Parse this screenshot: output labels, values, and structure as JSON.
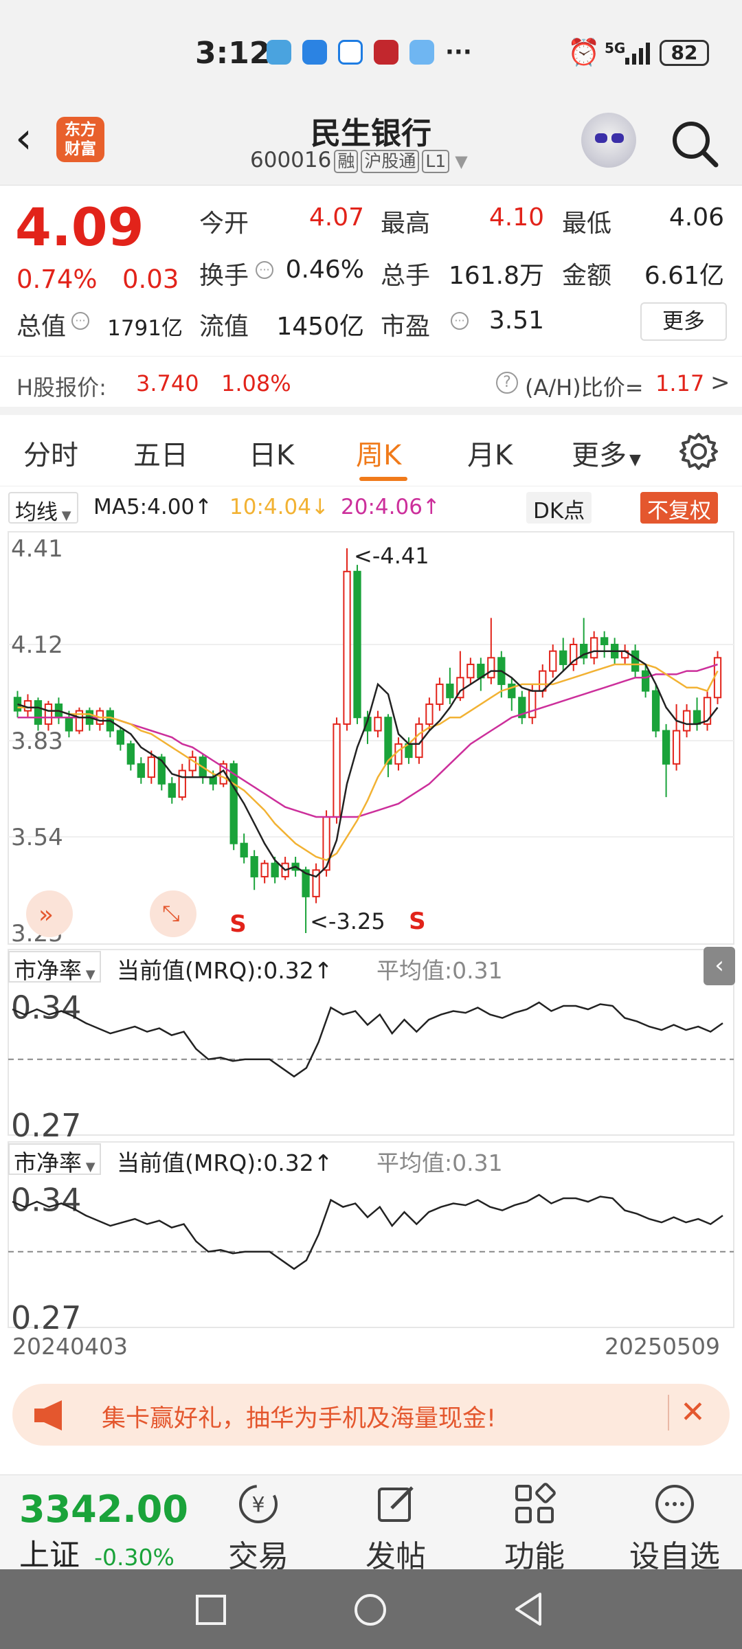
{
  "status": {
    "time": "3:12",
    "battery": "82",
    "network": "5G"
  },
  "header": {
    "title": "民生银行",
    "code": "600016",
    "tags": [
      "融",
      "沪股通",
      "L1"
    ],
    "logo_text": [
      "东方",
      "财富"
    ]
  },
  "quote": {
    "price": "4.09",
    "change_pct": "0.74%",
    "change": "0.03",
    "fields": [
      {
        "label": "今开",
        "value": "4.07",
        "color": "red"
      },
      {
        "label": "最高",
        "value": "4.10",
        "color": "red"
      },
      {
        "label": "最低",
        "value": "4.06",
        "color": "black"
      },
      {
        "label": "换手",
        "value": "0.46%",
        "color": "black"
      },
      {
        "label": "总手",
        "value": "161.8万",
        "color": "black"
      },
      {
        "label": "金额",
        "value": "6.61亿",
        "color": "black"
      },
      {
        "label": "总值",
        "value": "1791亿",
        "color": "black"
      },
      {
        "label": "流值",
        "value": "1450亿",
        "color": "black"
      },
      {
        "label": "市盈",
        "value": "3.51",
        "color": "black"
      }
    ],
    "more_label": "更多",
    "h_label": "H股报价:",
    "h_price": "3.740",
    "h_pct": "1.08%",
    "ah_label": "(A/H)比价=",
    "ah_value": "1.17",
    "ah_arrow": ">"
  },
  "tabs": [
    "分时",
    "五日",
    "日K",
    "周K",
    "月K",
    "更多"
  ],
  "active_tab": "周K",
  "ma": {
    "selector": "均线",
    "ma5": "MA5:4.00↑",
    "ma10": "10:4.04↓",
    "ma20": "20:4.06↑",
    "dk": "DK点",
    "fq": "不复权"
  },
  "colors": {
    "up": "#e2231a",
    "down": "#1aa33a",
    "ma5": "#222222",
    "ma10": "#f2b233",
    "ma20": "#cc2f9b",
    "accent": "#f07a1a"
  },
  "chart_data": {
    "type": "candlestick",
    "y_ticks": [
      "4.41",
      "4.12",
      "3.83",
      "3.54",
      "3.25"
    ],
    "ylim": [
      3.25,
      4.41
    ],
    "high_label": "<-4.41",
    "low_label": "<-3.25",
    "signal_label": "S",
    "candles": [
      [
        3.96,
        3.92,
        3.98,
        3.9
      ],
      [
        3.92,
        3.95,
        3.97,
        3.9
      ],
      [
        3.95,
        3.88,
        3.96,
        3.86
      ],
      [
        3.88,
        3.94,
        3.95,
        3.86
      ],
      [
        3.94,
        3.9,
        3.96,
        3.88
      ],
      [
        3.9,
        3.86,
        3.92,
        3.84
      ],
      [
        3.86,
        3.92,
        3.93,
        3.85
      ],
      [
        3.92,
        3.88,
        3.93,
        3.86
      ],
      [
        3.88,
        3.92,
        3.93,
        3.86
      ],
      [
        3.92,
        3.86,
        3.93,
        3.84
      ],
      [
        3.86,
        3.82,
        3.87,
        3.8
      ],
      [
        3.82,
        3.76,
        3.83,
        3.74
      ],
      [
        3.76,
        3.72,
        3.78,
        3.7
      ],
      [
        3.72,
        3.78,
        3.8,
        3.7
      ],
      [
        3.78,
        3.7,
        3.79,
        3.68
      ],
      [
        3.7,
        3.66,
        3.72,
        3.64
      ],
      [
        3.66,
        3.74,
        3.76,
        3.65
      ],
      [
        3.74,
        3.78,
        3.8,
        3.72
      ],
      [
        3.78,
        3.72,
        3.79,
        3.7
      ],
      [
        3.72,
        3.7,
        3.74,
        3.68
      ],
      [
        3.7,
        3.76,
        3.77,
        3.69
      ],
      [
        3.76,
        3.52,
        3.77,
        3.5
      ],
      [
        3.52,
        3.48,
        3.55,
        3.46
      ],
      [
        3.48,
        3.42,
        3.5,
        3.38
      ],
      [
        3.42,
        3.46,
        3.47,
        3.4
      ],
      [
        3.46,
        3.42,
        3.48,
        3.4
      ],
      [
        3.42,
        3.46,
        3.48,
        3.41
      ],
      [
        3.46,
        3.44,
        3.48,
        3.42
      ],
      [
        3.44,
        3.36,
        3.45,
        3.25
      ],
      [
        3.36,
        3.44,
        3.46,
        3.34
      ],
      [
        3.44,
        3.6,
        3.62,
        3.42
      ],
      [
        3.6,
        3.88,
        3.9,
        3.58
      ],
      [
        3.88,
        4.34,
        4.41,
        3.86
      ],
      [
        4.34,
        3.9,
        4.36,
        3.88
      ],
      [
        3.9,
        3.86,
        3.92,
        3.82
      ],
      [
        3.86,
        3.9,
        3.92,
        3.84
      ],
      [
        3.9,
        3.76,
        3.91,
        3.72
      ],
      [
        3.76,
        3.82,
        3.84,
        3.74
      ],
      [
        3.82,
        3.78,
        3.84,
        3.76
      ],
      [
        3.78,
        3.88,
        3.9,
        3.76
      ],
      [
        3.88,
        3.94,
        3.96,
        3.86
      ],
      [
        3.94,
        4.0,
        4.02,
        3.92
      ],
      [
        4.0,
        3.96,
        4.05,
        3.94
      ],
      [
        3.96,
        4.02,
        4.1,
        3.95
      ],
      [
        4.02,
        4.06,
        4.08,
        4.0
      ],
      [
        4.06,
        4.02,
        4.08,
        3.98
      ],
      [
        4.02,
        4.08,
        4.2,
        4.0
      ],
      [
        4.08,
        4.0,
        4.1,
        3.96
      ],
      [
        4.0,
        3.96,
        4.02,
        3.92
      ],
      [
        3.96,
        3.9,
        3.98,
        3.88
      ],
      [
        3.9,
        3.98,
        4.0,
        3.88
      ],
      [
        3.98,
        4.04,
        4.06,
        3.96
      ],
      [
        4.04,
        4.1,
        4.12,
        4.02
      ],
      [
        4.1,
        4.06,
        4.14,
        4.04
      ],
      [
        4.06,
        4.12,
        4.14,
        4.04
      ],
      [
        4.12,
        4.08,
        4.2,
        4.06
      ],
      [
        4.08,
        4.14,
        4.16,
        4.06
      ],
      [
        4.14,
        4.12,
        4.16,
        4.08
      ],
      [
        4.12,
        4.08,
        4.14,
        4.06
      ],
      [
        4.08,
        4.1,
        4.12,
        4.06
      ],
      [
        4.1,
        4.04,
        4.12,
        4.02
      ],
      [
        4.04,
        3.98,
        4.06,
        3.96
      ],
      [
        3.98,
        3.86,
        4.0,
        3.84
      ],
      [
        3.86,
        3.76,
        3.88,
        3.66
      ],
      [
        3.76,
        3.86,
        3.94,
        3.74
      ],
      [
        3.86,
        3.92,
        3.94,
        3.84
      ],
      [
        3.92,
        3.88,
        3.96,
        3.86
      ],
      [
        3.88,
        3.96,
        3.98,
        3.86
      ],
      [
        3.96,
        4.08,
        4.1,
        3.94
      ]
    ],
    "ma5": [
      3.94,
      3.93,
      3.93,
      3.92,
      3.92,
      3.91,
      3.9,
      3.9,
      3.89,
      3.89,
      3.87,
      3.85,
      3.81,
      3.79,
      3.77,
      3.73,
      3.72,
      3.72,
      3.72,
      3.72,
      3.74,
      3.69,
      3.64,
      3.58,
      3.52,
      3.47,
      3.44,
      3.45,
      3.43,
      3.42,
      3.45,
      3.53,
      3.7,
      3.81,
      3.89,
      4.0,
      3.97,
      3.85,
      3.82,
      3.82,
      3.86,
      3.89,
      3.93,
      3.98,
      4.0,
      4.02,
      4.04,
      4.04,
      4.02,
      3.99,
      3.98,
      3.98,
      4.01,
      4.04,
      4.07,
      4.09,
      4.1,
      4.1,
      4.1,
      4.1,
      4.08,
      4.06,
      4.0,
      3.93,
      3.89,
      3.88,
      3.88,
      3.89,
      3.93
    ],
    "ma10": [
      3.93,
      3.93,
      3.93,
      3.92,
      3.92,
      3.91,
      3.91,
      3.91,
      3.9,
      3.9,
      3.89,
      3.88,
      3.86,
      3.85,
      3.83,
      3.81,
      3.79,
      3.77,
      3.75,
      3.73,
      3.72,
      3.7,
      3.68,
      3.65,
      3.62,
      3.58,
      3.55,
      3.52,
      3.5,
      3.48,
      3.47,
      3.49,
      3.54,
      3.59,
      3.65,
      3.72,
      3.77,
      3.8,
      3.82,
      3.85,
      3.87,
      3.88,
      3.9,
      3.9,
      3.92,
      3.94,
      3.96,
      3.98,
      3.99,
      4.0,
      4.0,
      4.0,
      4.0,
      4.01,
      4.02,
      4.03,
      4.04,
      4.05,
      4.06,
      4.06,
      4.06,
      4.06,
      4.05,
      4.03,
      4.01,
      3.99,
      3.99,
      3.98,
      4.04
    ],
    "ma20": [
      3.9,
      3.9,
      3.9,
      3.9,
      3.9,
      3.9,
      3.9,
      3.9,
      3.9,
      3.9,
      3.89,
      3.88,
      3.87,
      3.86,
      3.85,
      3.84,
      3.82,
      3.81,
      3.79,
      3.77,
      3.75,
      3.73,
      3.71,
      3.69,
      3.67,
      3.65,
      3.63,
      3.62,
      3.61,
      3.6,
      3.6,
      3.6,
      3.6,
      3.6,
      3.61,
      3.62,
      3.63,
      3.64,
      3.66,
      3.68,
      3.7,
      3.73,
      3.76,
      3.79,
      3.82,
      3.84,
      3.86,
      3.88,
      3.9,
      3.91,
      3.92,
      3.93,
      3.94,
      3.95,
      3.96,
      3.97,
      3.98,
      3.99,
      4.0,
      4.01,
      4.02,
      4.02,
      4.03,
      4.03,
      4.03,
      4.04,
      4.04,
      4.05,
      4.06
    ],
    "indicators": [
      {
        "selector": "市净率",
        "current": "当前值(MRQ):0.32↑",
        "avg": "平均值:0.31",
        "ticks": [
          "0.34",
          "0.27"
        ],
        "ylim": [
          0.27,
          0.345
        ],
        "avg_value": 0.31,
        "values": [
          0.339,
          0.336,
          0.339,
          0.336,
          0.338,
          0.335,
          0.331,
          0.328,
          0.325,
          0.327,
          0.329,
          0.326,
          0.328,
          0.324,
          0.326,
          0.316,
          0.31,
          0.311,
          0.309,
          0.31,
          0.31,
          0.31,
          0.305,
          0.3,
          0.305,
          0.32,
          0.34,
          0.336,
          0.338,
          0.33,
          0.336,
          0.325,
          0.333,
          0.326,
          0.333,
          0.336,
          0.338,
          0.337,
          0.34,
          0.336,
          0.334,
          0.337,
          0.339,
          0.343,
          0.338,
          0.341,
          0.341,
          0.339,
          0.342,
          0.341,
          0.334,
          0.332,
          0.329,
          0.327,
          0.33,
          0.327,
          0.329,
          0.326,
          0.331
        ]
      },
      {
        "selector": "市净率",
        "current": "当前值(MRQ):0.32↑",
        "avg": "平均值:0.31",
        "ticks": [
          "0.34",
          "0.27"
        ],
        "ylim": [
          0.27,
          0.345
        ],
        "avg_value": 0.31,
        "values": [
          0.339,
          0.336,
          0.339,
          0.336,
          0.338,
          0.335,
          0.331,
          0.328,
          0.325,
          0.327,
          0.329,
          0.326,
          0.328,
          0.324,
          0.326,
          0.316,
          0.31,
          0.311,
          0.309,
          0.31,
          0.31,
          0.31,
          0.305,
          0.3,
          0.305,
          0.32,
          0.34,
          0.336,
          0.338,
          0.33,
          0.336,
          0.325,
          0.333,
          0.326,
          0.333,
          0.336,
          0.338,
          0.337,
          0.34,
          0.336,
          0.334,
          0.337,
          0.339,
          0.343,
          0.338,
          0.341,
          0.341,
          0.339,
          0.342,
          0.341,
          0.334,
          0.332,
          0.329,
          0.327,
          0.33,
          0.327,
          0.329,
          0.326,
          0.331
        ]
      }
    ],
    "date_start": "20240403",
    "date_end": "20250509"
  },
  "banner": {
    "text": "集卡赢好礼，抽华为手机及海量现金!"
  },
  "bottom": {
    "index_value": "3342.00",
    "index_name": "上证",
    "index_change": "-0.30%",
    "items": [
      {
        "label": "交易",
        "icon": "yen-icon"
      },
      {
        "label": "发帖",
        "icon": "edit-icon"
      },
      {
        "label": "功能",
        "icon": "grid-icon"
      },
      {
        "label": "设自选",
        "icon": "more-icon"
      }
    ]
  }
}
